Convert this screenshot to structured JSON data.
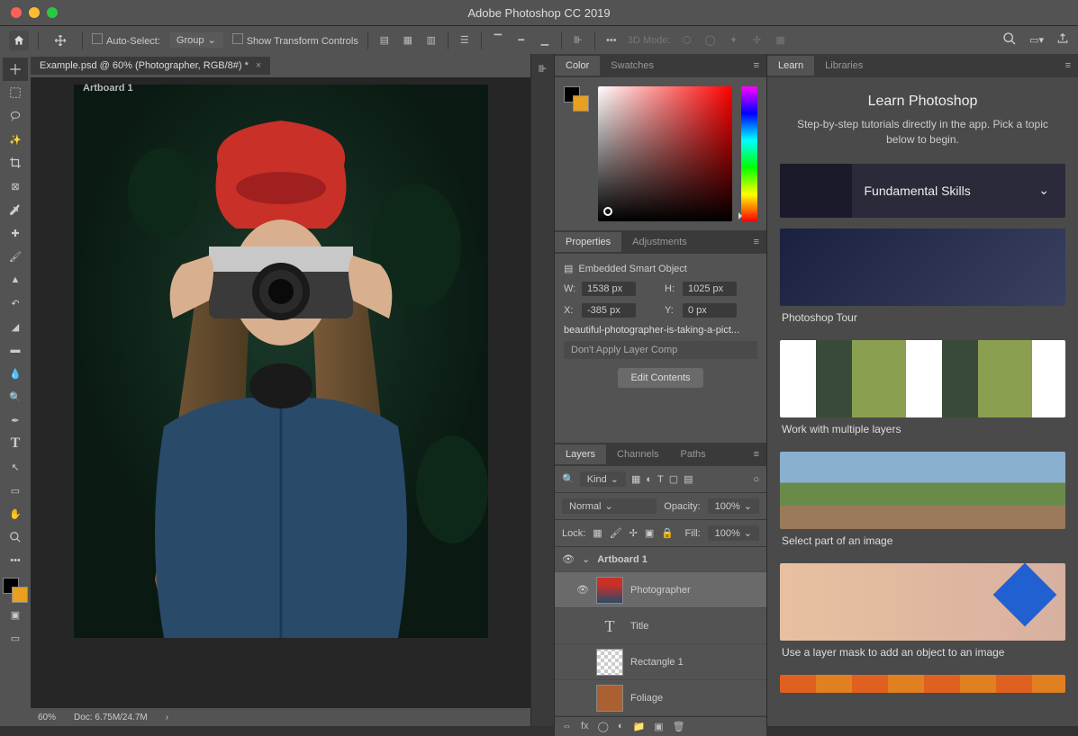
{
  "app": {
    "title": "Adobe Photoshop CC 2019"
  },
  "options": {
    "auto_select": "Auto-Select:",
    "group": "Group",
    "transform": "Show Transform Controls",
    "mode3d": "3D Mode:"
  },
  "doc": {
    "tab": "Example.psd @ 60% (Photographer, RGB/8#) *",
    "artboard": "Artboard 1",
    "zoom": "60%",
    "docsize": "Doc: 6.75M/24.7M"
  },
  "panels": {
    "color": "Color",
    "swatches": "Swatches",
    "properties": "Properties",
    "adjustments": "Adjustments",
    "layers": "Layers",
    "channels": "Channels",
    "paths": "Paths",
    "learn": "Learn",
    "libraries": "Libraries"
  },
  "props": {
    "type": "Embedded Smart Object",
    "w_lbl": "W:",
    "w_val": "1538 px",
    "h_lbl": "H:",
    "h_val": "1025 px",
    "x_lbl": "X:",
    "x_val": "-385 px",
    "y_lbl": "Y:",
    "y_val": "0 px",
    "file": "beautiful-photographer-is-taking-a-pict...",
    "comp": "Don't Apply Layer Comp",
    "edit": "Edit Contents"
  },
  "layers": {
    "kind": "Kind",
    "blend": "Normal",
    "opacity_lbl": "Opacity:",
    "opacity_val": "100%",
    "lock_lbl": "Lock:",
    "fill_lbl": "Fill:",
    "fill_val": "100%",
    "items": [
      {
        "name": "Artboard 1",
        "type": "artboard"
      },
      {
        "name": "Photographer",
        "type": "smart",
        "sel": true
      },
      {
        "name": "Title",
        "type": "text"
      },
      {
        "name": "Rectangle 1",
        "type": "shape"
      },
      {
        "name": "Foliage",
        "type": "smart"
      }
    ]
  },
  "learn": {
    "title": "Learn Photoshop",
    "sub": "Step-by-step tutorials directly in the app. Pick a topic below to begin.",
    "cat": "Fundamental Skills",
    "cards": [
      "Photoshop Tour",
      "Work with multiple layers",
      "Select part of an image",
      "Use a layer mask to add an object to an image"
    ]
  }
}
